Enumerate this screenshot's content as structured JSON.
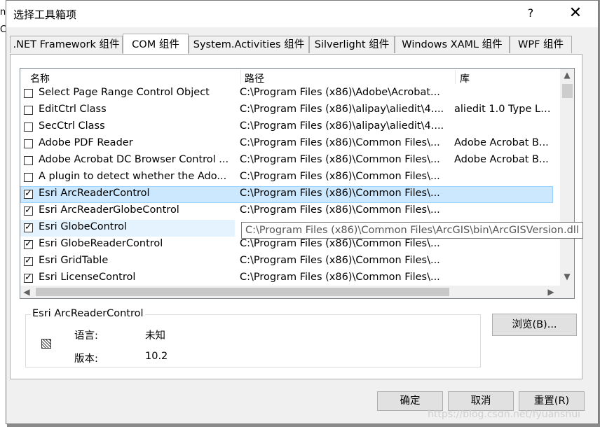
{
  "background": {
    "left_text_1": "n",
    "left_text_2": "C"
  },
  "dialog": {
    "title": "选择工具箱项",
    "help_label": "?",
    "close_label": "✕"
  },
  "tabs": [
    {
      "label": ".NET Framework 组件"
    },
    {
      "label": "COM 组件"
    },
    {
      "label": "System.Activities 组件"
    },
    {
      "label": "Silverlight 组件"
    },
    {
      "label": "Windows XAML 组件"
    },
    {
      "label": "WPF 组件"
    }
  ],
  "list": {
    "columns": {
      "name": "名称",
      "path": "路径",
      "lib": "库"
    },
    "rows": [
      {
        "checked": false,
        "name": "Select Page Range Control Object",
        "path": "C:\\Program Files (x86)\\Adobe\\Acrobat...",
        "lib": ""
      },
      {
        "checked": false,
        "name": "EditCtrl Class",
        "path": "C:\\Program Files (x86)\\alipay\\aliedit\\4....",
        "lib": "aliedit 1.0 Type Li..."
      },
      {
        "checked": false,
        "name": "SecCtrl Class",
        "path": "C:\\Program Files (x86)\\alipay\\aliedit\\4....",
        "lib": ""
      },
      {
        "checked": false,
        "name": "Adobe PDF Reader",
        "path": "C:\\Program Files (x86)\\Common Files\\...",
        "lib": "Adobe Acrobat B..."
      },
      {
        "checked": false,
        "name": "Adobe Acrobat DC Browser Control ...",
        "path": "C:\\Program Files (x86)\\Common Files\\...",
        "lib": "Adobe Acrobat B..."
      },
      {
        "checked": false,
        "name": "A plugin to detect whether the Ado...",
        "path": "C:\\Program Files (x86)\\Common Files\\...",
        "lib": ""
      },
      {
        "checked": true,
        "name": "Esri ArcReaderControl",
        "path": "C:\\Program Files (x86)\\Common Files\\...",
        "lib": ""
      },
      {
        "checked": true,
        "name": "Esri ArcReaderGlobeControl",
        "path": "C:\\Program Files (x86)\\Common Files\\...",
        "lib": ""
      },
      {
        "checked": true,
        "name": "Esri GlobeControl",
        "path": "",
        "lib": ""
      },
      {
        "checked": true,
        "name": "Esri GlobeReaderControl",
        "path": "C:\\Program Files (x86)\\Common Files\\...",
        "lib": ""
      },
      {
        "checked": true,
        "name": "Esri GridTable",
        "path": "C:\\Program Files (x86)\\Common Files\\...",
        "lib": ""
      },
      {
        "checked": true,
        "name": "Esri LicenseControl",
        "path": "C:\\Program Files (x86)\\Common Files\\...",
        "lib": ""
      }
    ],
    "tooltip": "C:\\Program Files (x86)\\Common Files\\ArcGIS\\bin\\ArcGISVersion.dll"
  },
  "details": {
    "group_title": "Esri ArcReaderControl",
    "language_label": "语言:",
    "language_value": "未知",
    "version_label": "版本:",
    "version_value": "10.2"
  },
  "buttons": {
    "browse": "浏览(B)...",
    "ok": "确定",
    "cancel": "取消",
    "reset": "重置(R)"
  },
  "watermark": "https://blog.csdn.net/fyuanshui"
}
